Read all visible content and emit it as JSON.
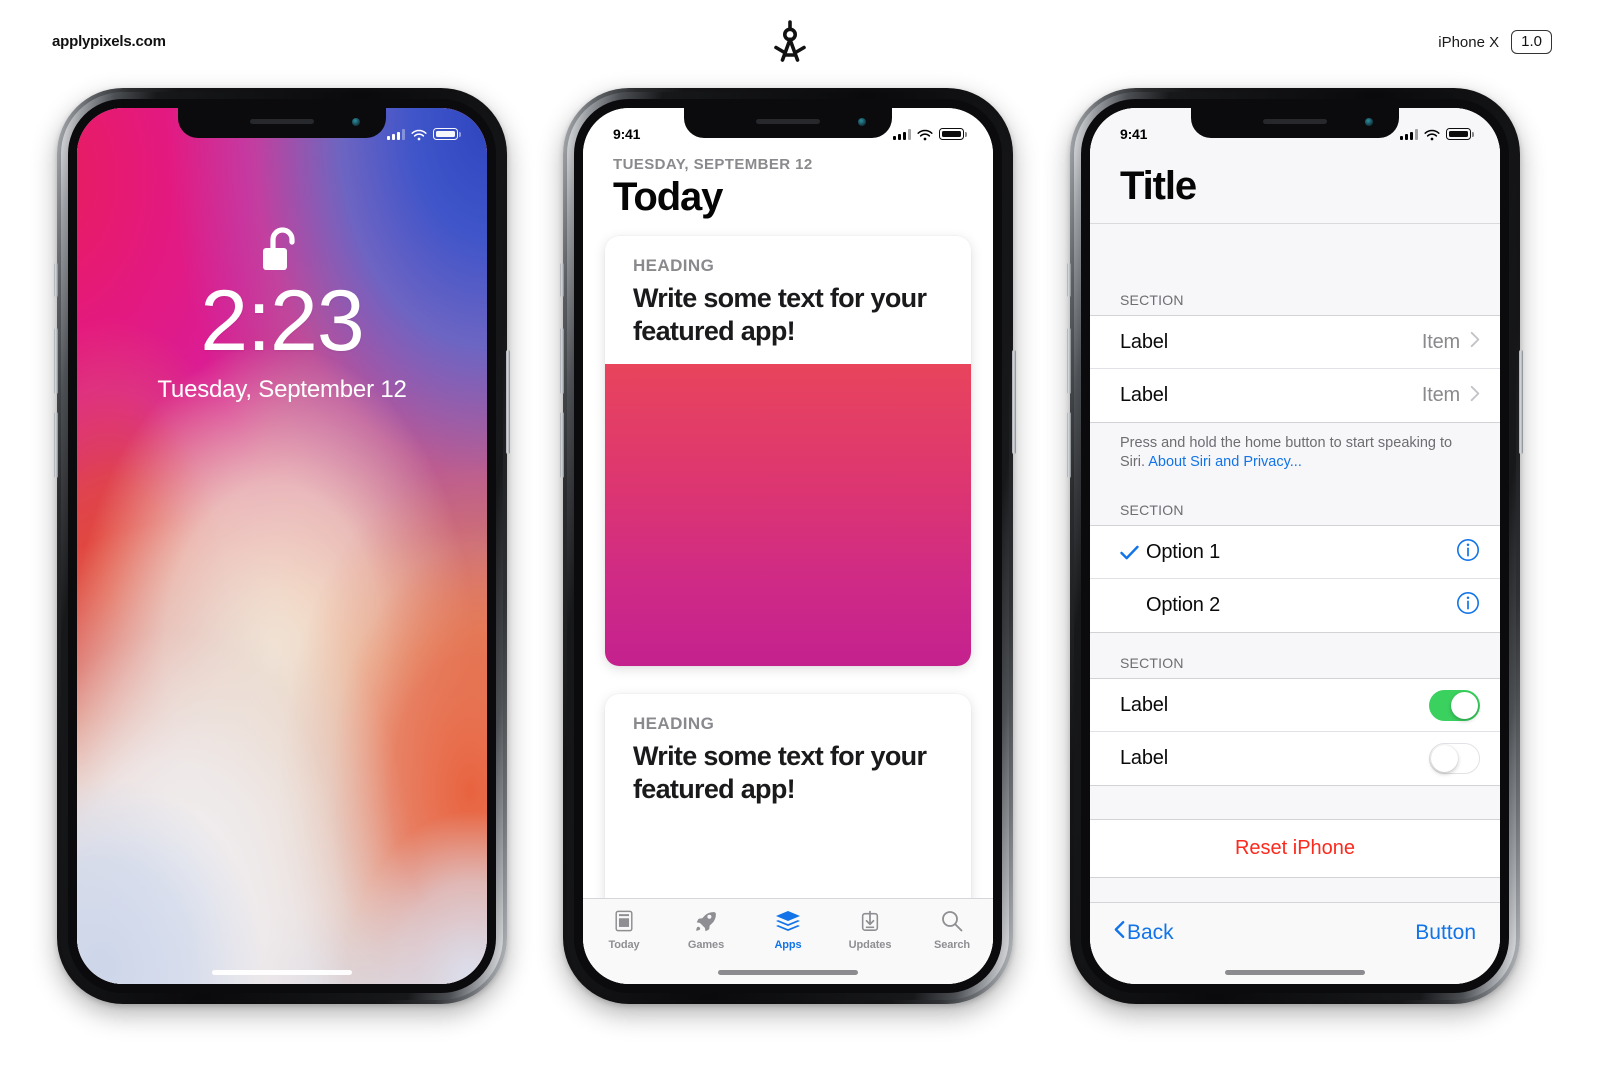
{
  "header": {
    "brand": "applypixels.com",
    "logo_icon": "compass-divider-icon",
    "device_label": "iPhone X",
    "version_badge": "1.0"
  },
  "phone_lockscreen": {
    "name": "iPhone X Lock Screen",
    "statusbar": {
      "time": "",
      "signal_icon": "cellular-bars-icon",
      "wifi_icon": "wifi-icon",
      "battery_icon": "battery-full-icon"
    },
    "lock_icon": "unlocked-padlock-icon",
    "time": "2:23",
    "date": "Tuesday, September 12",
    "home_indicator": "home-indicator"
  },
  "phone_appstore": {
    "name": "App Store Today",
    "statusbar": {
      "time": "9:41",
      "signal_icon": "cellular-bars-icon",
      "wifi_icon": "wifi-icon",
      "battery_icon": "battery-full-icon"
    },
    "date": "TUESDAY, SEPTEMBER 12",
    "title": "Today",
    "cards": [
      {
        "heading": "HEADING",
        "text": "Write some text for your featured app!",
        "image_gradient_from": "#e8445c",
        "image_gradient_to": "#c4218f"
      },
      {
        "heading": "HEADING",
        "text": "Write some text for your featured app!"
      }
    ],
    "tabs": [
      {
        "label": "Today",
        "icon": "newspaper-icon",
        "active": false
      },
      {
        "label": "Games",
        "icon": "rocket-icon",
        "active": false
      },
      {
        "label": "Apps",
        "icon": "layers-stack-icon",
        "active": true
      },
      {
        "label": "Updates",
        "icon": "download-box-icon",
        "active": false
      },
      {
        "label": "Search",
        "icon": "magnifier-icon",
        "active": false
      }
    ],
    "accent_color": "#1274e8"
  },
  "phone_settings": {
    "name": "Settings Table View",
    "statusbar": {
      "time": "9:41",
      "signal_icon": "cellular-bars-icon",
      "wifi_icon": "wifi-icon",
      "battery_icon": "battery-full-icon"
    },
    "title": "Title",
    "section1": {
      "header": "SECTION",
      "rows": [
        {
          "label": "Label",
          "value": "Item",
          "accessory_icon": "chevron-right-icon"
        },
        {
          "label": "Label",
          "value": "Item",
          "accessory_icon": "chevron-right-icon"
        }
      ],
      "footnote_text": "Press and hold the home button to start speaking to Siri. ",
      "footnote_link": "About Siri and Privacy..."
    },
    "section2": {
      "header": "SECTION",
      "rows": [
        {
          "label": "Option 1",
          "checked": true,
          "accessory_icon": "info-circle-icon",
          "check_icon": "checkmark-icon"
        },
        {
          "label": "Option 2",
          "checked": false,
          "accessory_icon": "info-circle-icon",
          "check_icon": ""
        }
      ]
    },
    "section3": {
      "header": "SECTION",
      "rows": [
        {
          "label": "Label",
          "toggle": "on"
        },
        {
          "label": "Label",
          "toggle": "off"
        }
      ]
    },
    "destructive_action": "Reset iPhone",
    "toolbar": {
      "back_label": "Back",
      "back_icon": "chevron-left-icon",
      "button_label": "Button"
    },
    "accent_color": "#1274e8",
    "destructive_color": "#fb2a1d",
    "toggle_on_color": "#3ad15f"
  }
}
